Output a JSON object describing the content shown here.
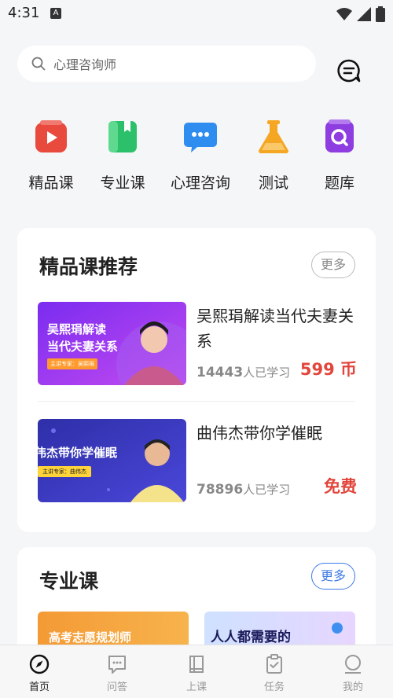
{
  "status_bar": {
    "time": "4:31",
    "notif_glyph": "A"
  },
  "search": {
    "placeholder": "心理咨询师"
  },
  "categories": [
    {
      "label": "精品课",
      "icon": "play-video-icon",
      "color": "#e84a3e"
    },
    {
      "label": "专业课",
      "icon": "book-icon",
      "color": "#2cc06a"
    },
    {
      "label": "心理咨询",
      "icon": "chat-bubble-icon",
      "color": "#2f8df0"
    },
    {
      "label": "测试",
      "icon": "flask-icon",
      "color": "#f5a623"
    },
    {
      "label": "题库",
      "icon": "question-bank-icon",
      "color": "#8e3de0"
    }
  ],
  "featured": {
    "title": "精品课推荐",
    "more": "更多",
    "courses": [
      {
        "title": "吴熙琄解读当代夫妻关系",
        "banner_line1": "吴熙琄解读",
        "banner_line2": "当代夫妻关系",
        "banner_tag": "主讲专家：吴熙琄",
        "learners_count": "14443",
        "learners_suffix": "人已学习",
        "price": "599 币"
      },
      {
        "title": "曲伟杰带你学催眠",
        "banner_line1": "伟杰带你学催眠",
        "banner_tag": "主讲专家：曲伟杰",
        "learners_count": "78896",
        "learners_suffix": "人已学习",
        "price": "免费"
      }
    ]
  },
  "professional": {
    "title": "专业课",
    "more": "更多",
    "thumbs": [
      {
        "text": "高考志愿规划师"
      },
      {
        "text": "人人都需要的"
      }
    ]
  },
  "bottom_nav": [
    {
      "label": "首页",
      "icon": "compass-icon",
      "active": true
    },
    {
      "label": "问答",
      "icon": "qa-bubble-icon",
      "active": false
    },
    {
      "label": "上课",
      "icon": "book-open-icon",
      "active": false
    },
    {
      "label": "任务",
      "icon": "clipboard-check-icon",
      "active": false
    },
    {
      "label": "我的",
      "icon": "user-icon",
      "active": false
    }
  ],
  "colors": {
    "accent": "#3e79e6",
    "price_red": "#e2453b"
  }
}
